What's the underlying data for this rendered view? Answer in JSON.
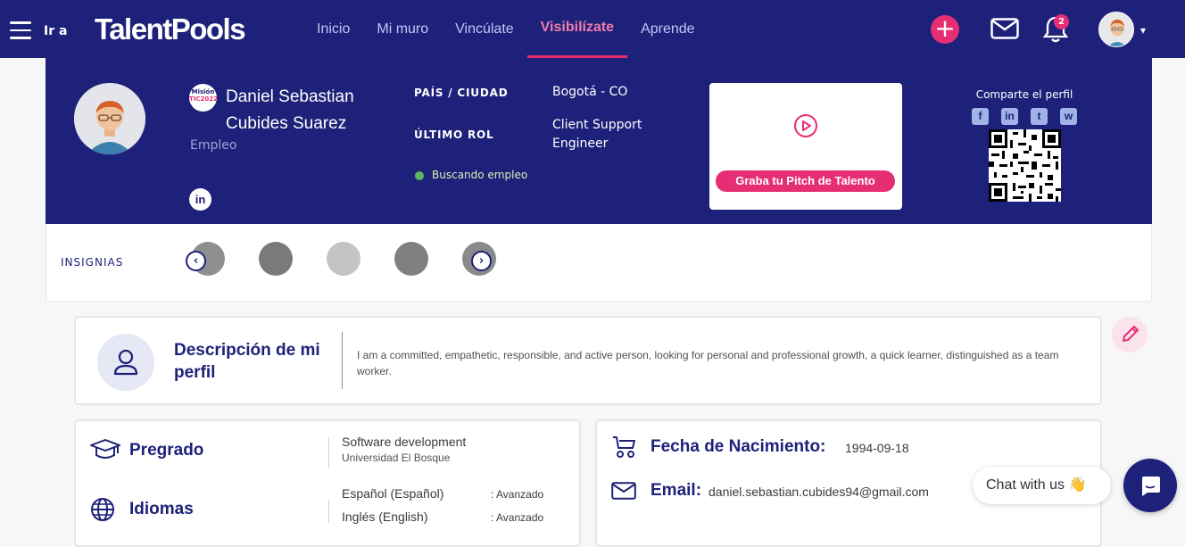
{
  "topbar": {
    "ira_label": "Ir a",
    "logo_text": "TalentPools",
    "nav": [
      {
        "label": "Inicio",
        "active": false
      },
      {
        "label": "Mi muro",
        "active": false
      },
      {
        "label": "Vincúlate",
        "active": false
      },
      {
        "label": "Visibilízate",
        "active": true
      },
      {
        "label": "Aprende",
        "active": false
      }
    ],
    "notifications_count": "2"
  },
  "profile": {
    "mision_logo_line1": "Misión",
    "mision_logo_line2": "TIC2022",
    "name": "Daniel Sebastian Cubides Suarez",
    "role_tag": "Empleo",
    "linkedin_label": "in",
    "pais_label": "PAÍS / CIUDAD",
    "pais_value": "Bogotá - CO",
    "rol_label": "ÚLTIMO ROL",
    "rol_value": "Client Support Engineer",
    "status": "Buscando empleo",
    "pitch_button": "Graba tu Pitch de Talento",
    "share_label": "Comparte el perfil",
    "social": [
      "f",
      "in",
      "t",
      "w"
    ]
  },
  "insignias": {
    "label": "INSIGNIAS"
  },
  "descripcion": {
    "title": "Descripción de mi perfil",
    "text": "I am a committed, empathetic, responsible, and active person, looking for personal and professional growth, a quick learner, distinguished as a team worker."
  },
  "educacion": {
    "pregrado_title": "Pregrado",
    "pregrado_program": "Software development",
    "pregrado_school": "Universidad El Bosque",
    "idiomas_title": "Idiomas",
    "idiomas": [
      {
        "lang": "Español (Español)",
        "level": ": Avanzado"
      },
      {
        "lang": "Inglés (English)",
        "level": ": Avanzado"
      }
    ]
  },
  "info": {
    "nacimiento_label": "Fecha de Nacimiento:",
    "nacimiento_value": "1994-09-18",
    "email_label": "Email:",
    "email_value": "daniel.sebastian.cubides94@gmail.com"
  },
  "chat": {
    "pill_text": "Chat with us 👋"
  },
  "colors": {
    "navy": "#1e2179",
    "pink": "#e62e74",
    "nav_inactive": "#c3c6f3"
  }
}
